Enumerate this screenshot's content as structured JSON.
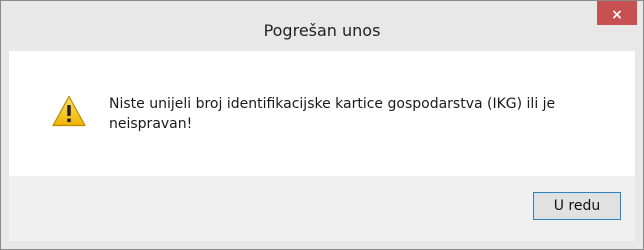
{
  "dialog": {
    "title": "Pogrešan unos",
    "close_label": "×",
    "message": "Niste unijeli broj identifikacijske kartice gospodarstva (IKG) ili je neispravan!",
    "icon": "warning-icon",
    "ok_label": "U redu"
  },
  "colors": {
    "close_button": "#c75050",
    "warning_fill": "#f2c200",
    "focus_border": "#3c7fb1"
  }
}
